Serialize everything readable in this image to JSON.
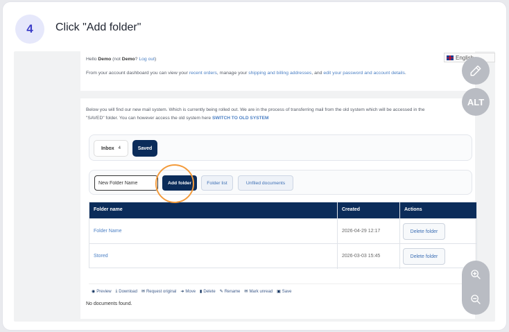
{
  "step": {
    "number": "4",
    "instruction": "Click \"Add folder\""
  },
  "language": {
    "label": "English"
  },
  "greeting": {
    "hello": "Hello",
    "user": "Demo",
    "not_prefix": "(not",
    "not_user": "Demo",
    "not_suffix": "?",
    "logout": "Log out",
    "logout_suffix": ")"
  },
  "dashboard": {
    "intro": "From your account dashboard you can view your",
    "link_orders": "recent orders",
    "mid": ", manage your",
    "link_addresses": "shipping and billing addresses",
    "and": ", and",
    "link_password": "edit your password and account details",
    "end": "."
  },
  "mail_notice": {
    "line1": "Below you will find our new mail system. Which is currently being rolled out. We are in the process of transferring mail from the old system which will be accessed in the",
    "line2": "\"SAVED\" folder. You can however access the old system here",
    "switch_link": "SWITCH TO OLD SYSTEM"
  },
  "tabs": [
    {
      "label": "Inbox",
      "count": "4"
    },
    {
      "label": "Saved"
    }
  ],
  "actions": {
    "folder_input_value": "New Folder Name",
    "add_folder": "Add folder",
    "folder_list": "Folder list",
    "unfiled": "Unfiled documents"
  },
  "table": {
    "headers": [
      "Folder name",
      "Created",
      "Actions"
    ],
    "rows": [
      {
        "name": "Folder Name",
        "created": "2026-04-29 12:17",
        "action": "Delete folder"
      },
      {
        "name": "Stored",
        "created": "2026-03-03 15:45",
        "action": "Delete folder"
      }
    ]
  },
  "toolbar": [
    {
      "icon": "eye-icon",
      "label": "Preview"
    },
    {
      "icon": "download-icon",
      "label": "Download"
    },
    {
      "icon": "mail-icon",
      "label": "Request original"
    },
    {
      "icon": "move-icon",
      "label": "Move"
    },
    {
      "icon": "trash-icon",
      "label": "Delete"
    },
    {
      "icon": "pencil-icon",
      "label": "Rename"
    },
    {
      "icon": "mail-unread-icon",
      "label": "Mark unread"
    },
    {
      "icon": "save-icon",
      "label": "Save"
    }
  ],
  "empty_state": "No documents found.",
  "overlay": {
    "alt_label": "ALT"
  },
  "colors": {
    "accent": "#0b2c5a",
    "highlight": "#f39b3c",
    "step_badge": "#3d3ec8"
  }
}
